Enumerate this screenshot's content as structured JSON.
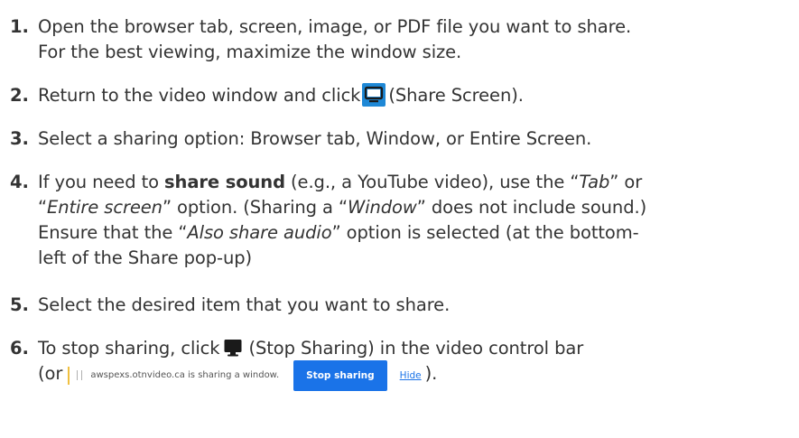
{
  "steps": [
    {
      "num": "1.",
      "line1": "Open the browser tab, screen, image, or PDF file you want to share.",
      "line2": "For the best viewing, maximize the window size."
    },
    {
      "num": "2.",
      "before": "Return to the video window and click",
      "after": "(Share Screen).",
      "icon": "share-screen-icon"
    },
    {
      "num": "3.",
      "text": "Select a sharing option: Browser tab, Window, or Entire Screen."
    },
    {
      "num": "4.",
      "l1a": "If you need to ",
      "l1b": "share sound",
      "l1c": " (e.g., a YouTube video), use the “",
      "l1d": "Tab",
      "l1e": "” or",
      "l2a": "“",
      "l2b": "Entire screen",
      "l2c": "” option. (Sharing a “",
      "l2d": "Window",
      "l2e": "” does not include sound.)",
      "l3a": "Ensure that the “",
      "l3b": "Also share audio",
      "l3c": "” option is selected (at the bottom-",
      "l4": "left of the Share pop-up)"
    },
    {
      "num": "5.",
      "text": "Select the desired item that you want to share."
    },
    {
      "num": "6.",
      "before": "To stop sharing, click",
      "after": "(Stop Sharing) in the video control bar",
      "line2_before": "(or",
      "line2_after": ").",
      "icon": "monitor-icon",
      "share_bar": {
        "message": "awspexs.otnvideo.ca is sharing a window.",
        "stop_label": "Stop sharing",
        "hide_label": "Hide"
      }
    }
  ],
  "colors": {
    "text": "#333333",
    "share_icon_bg": "#1e88d6",
    "stop_button": "#1a73e8",
    "hide_link": "#1a73e8"
  }
}
